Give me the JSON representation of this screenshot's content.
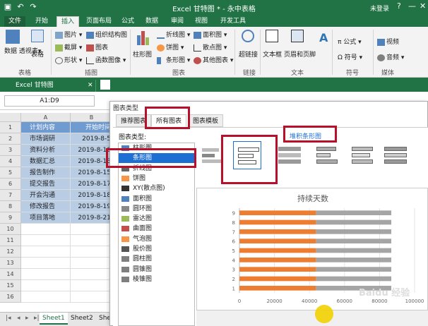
{
  "window": {
    "title": "Excel 甘特图 * - 永中表格",
    "status": "未登录",
    "controls": [
      "?",
      "—",
      "□",
      "✕"
    ]
  },
  "ribbon_tabs": [
    "文件",
    "开始",
    "插入",
    "页面布局",
    "公式",
    "数据",
    "审阅",
    "视图",
    "开发工具"
  ],
  "active_tab": "插入",
  "ribbon": {
    "table_group": {
      "label": "表格",
      "items": [
        "数据\n透视表▾",
        "表格"
      ]
    },
    "illus_group": {
      "label": "插图",
      "items": [
        "图片 ▾",
        "截屏 ▾",
        "形状 ▾",
        "组织结构图",
        "图表",
        "函数图像 ▾"
      ]
    },
    "chart_group": {
      "label": "图表",
      "items": [
        "柱形图",
        "折线图 ▾",
        "饼图 ▾",
        "条形图 ▾",
        "面积图 ▾",
        "散点图 ▾",
        "其他图表 ▾"
      ]
    },
    "link_group": {
      "label": "链接",
      "items": [
        "超链接"
      ]
    },
    "text_group": {
      "label": "文本",
      "items": [
        "文本框",
        "页眉和页脚",
        "A"
      ]
    },
    "symbol_group": {
      "label": "符号",
      "items": [
        "π 公式 ▾",
        "Ω 符号 ▾"
      ]
    },
    "media_group": {
      "label": "媒体",
      "items": [
        "视频",
        "音频 ▾"
      ]
    }
  },
  "workbook_tab": "Excel 甘特图",
  "name_box": "A1:D9",
  "sheet": {
    "columns": [
      "A",
      "B"
    ],
    "rows": [
      {
        "n": "1",
        "a": "计划内容",
        "b": "开始时间"
      },
      {
        "n": "2",
        "a": "市场调研",
        "b": "2019-8-5"
      },
      {
        "n": "3",
        "a": "资料分析",
        "b": "2019-8-10"
      },
      {
        "n": "4",
        "a": "数据汇总",
        "b": "2019-8-13"
      },
      {
        "n": "5",
        "a": "报告制作",
        "b": "2019-8-15"
      },
      {
        "n": "6",
        "a": "提交报告",
        "b": "2019-8-17"
      },
      {
        "n": "7",
        "a": "开会沟通",
        "b": "2019-8-18"
      },
      {
        "n": "8",
        "a": "修改报告",
        "b": "2019-8-19"
      },
      {
        "n": "9",
        "a": "项目落地",
        "b": "2019-8-21"
      },
      {
        "n": "10",
        "a": "",
        "b": ""
      },
      {
        "n": "11",
        "a": "",
        "b": ""
      },
      {
        "n": "12",
        "a": "",
        "b": ""
      },
      {
        "n": "13",
        "a": "",
        "b": ""
      },
      {
        "n": "14",
        "a": "",
        "b": ""
      },
      {
        "n": "15",
        "a": "",
        "b": ""
      },
      {
        "n": "16",
        "a": "",
        "b": ""
      }
    ],
    "tabs": [
      "Sheet1",
      "Sheet2",
      "She"
    ]
  },
  "dialog": {
    "title": "图表类型",
    "tabs": [
      "推荐图表",
      "所有图表",
      "图表模板"
    ],
    "active_tab": "所有图表",
    "type_label": "图表类型:",
    "types": [
      "柱形图",
      "条形图",
      "折线图",
      "饼图",
      "XY(散点图)",
      "面积图",
      "圆环图",
      "雷达图",
      "曲面图",
      "气泡图",
      "股价图",
      "圆柱图",
      "圆锥图",
      "棱锥图"
    ],
    "selected_type": "条形图",
    "subtype_label": "堆积条形图"
  },
  "chart_data": {
    "type": "bar",
    "title": "持续天数",
    "categories": [
      "1",
      "2",
      "3",
      "4",
      "5",
      "6",
      "7",
      "8",
      "9"
    ],
    "series": [
      {
        "values": [
          43700,
          43700,
          43700,
          43700,
          43700,
          43700,
          43700,
          43700,
          43700
        ]
      },
      {
        "values": [
          15,
          14,
          12,
          10,
          8,
          6,
          5,
          4,
          3
        ]
      }
    ],
    "xlim": [
      0,
      100000
    ],
    "xticks": [
      "0",
      "20000",
      "40000",
      "60000",
      "80000",
      "100000"
    ],
    "colors": {
      "start": "#ed7d31",
      "duration": "#a5a5a5"
    }
  },
  "colors": {
    "brand": "#217346",
    "highlight": "#b8102b",
    "selection": "#1e6fd4"
  },
  "watermark": "Baidu 经验"
}
